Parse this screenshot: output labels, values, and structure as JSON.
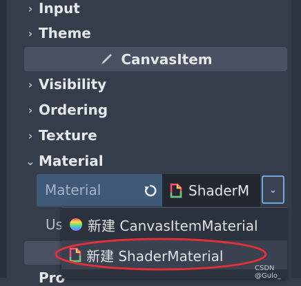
{
  "inspector": {
    "sections": {
      "input": "Input",
      "theme": "Theme",
      "visibility": "Visibility",
      "ordering": "Ordering",
      "texture": "Texture",
      "material": "Material"
    },
    "category_header": "CanvasItem",
    "material_property": {
      "label": "Material",
      "value": "ShaderM"
    },
    "use_label": "Us",
    "behind_text": "Pro"
  },
  "popup": {
    "item1": "新建 CanvasItemMaterial",
    "item2": "新建 ShaderMaterial"
  },
  "watermark": "CSDN @Gulo_",
  "colors": {
    "panel_bg": "#363d4a",
    "label_bg": "#3f5978",
    "accent": "#71a8e0",
    "highlight": "#e0303a"
  }
}
